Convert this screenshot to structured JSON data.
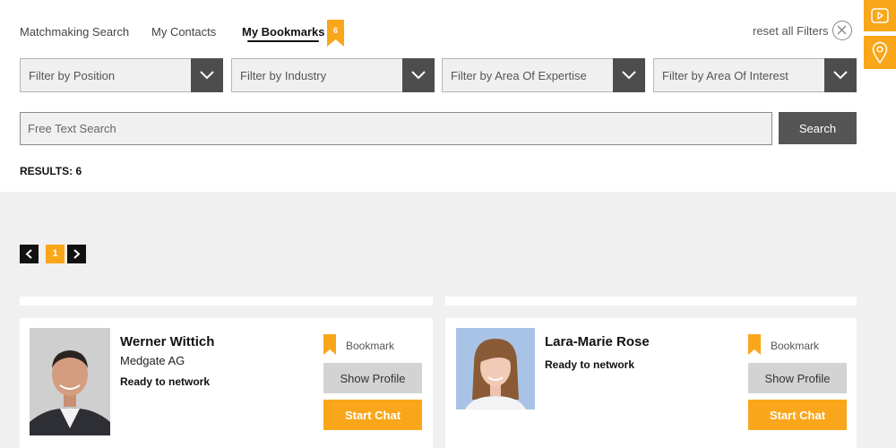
{
  "tabs": {
    "matchmaking": "Matchmaking Search",
    "contacts": "My Contacts",
    "bookmarks": "My Bookmarks",
    "bookmarks_count": "6"
  },
  "header": {
    "reset_label": "reset all Filters",
    "reset_icon": "close-circle-icon",
    "side_icons": [
      "video-play-icon",
      "location-pin-icon"
    ]
  },
  "filters": [
    {
      "label": "Filter by Position"
    },
    {
      "label": "Filter by Industry"
    },
    {
      "label": "Filter by Area Of Expertise"
    },
    {
      "label": "Filter by Area Of Interest"
    }
  ],
  "search": {
    "placeholder": "Free Text Search",
    "value": "",
    "button_label": "Search"
  },
  "results": {
    "label": "RESULTS: 6"
  },
  "pagination": {
    "current_page": "1",
    "prev_icon": "chevron-left-icon",
    "next_icon": "chevron-right-icon"
  },
  "cards": [
    {
      "name": "Werner Wittich",
      "company": "Medgate AG",
      "status": "Ready to network",
      "bookmark_label": "Bookmark",
      "show_profile_label": "Show Profile",
      "chat_label": "Start Chat"
    },
    {
      "name": "Lara-Marie Rose",
      "status": "Ready to network",
      "bookmark_label": "Bookmark",
      "show_profile_label": "Show Profile",
      "chat_label": "Start Chat"
    }
  ],
  "colors": {
    "accent": "#f9a61a",
    "dark_button": "#4d4d4d",
    "search_button": "#555555",
    "background": "#f0f0f0"
  }
}
